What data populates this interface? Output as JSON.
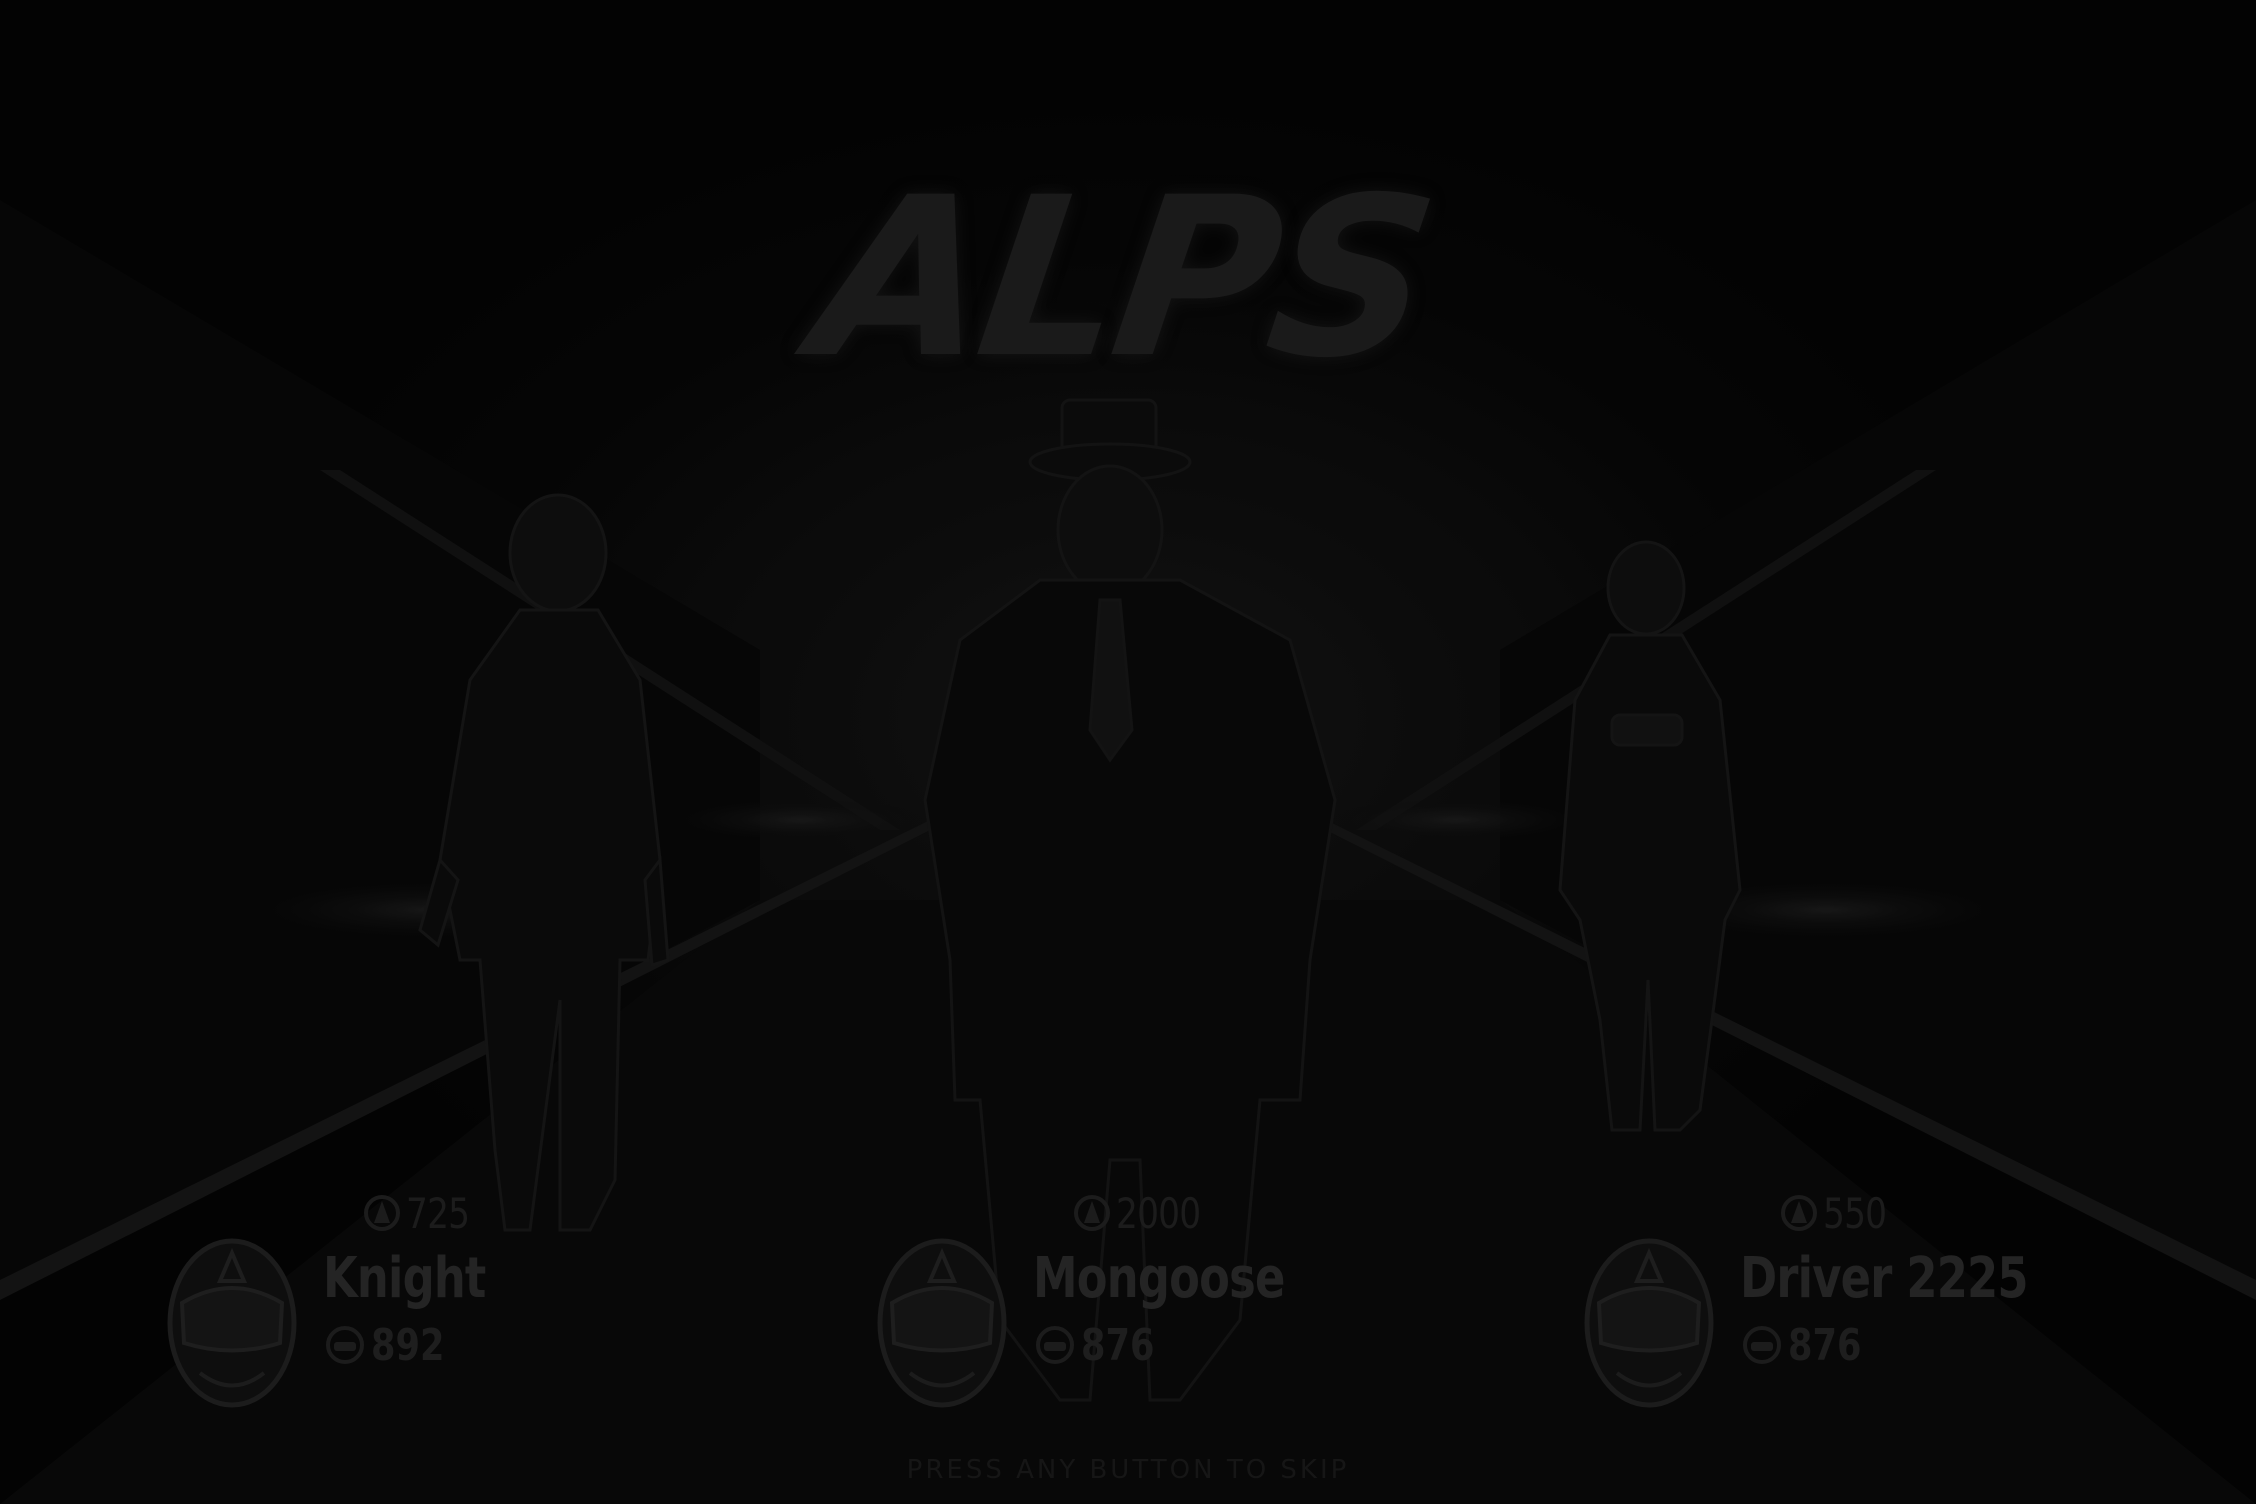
{
  "location_title": "ALPS",
  "drivers": [
    {
      "reputation": "725",
      "name": "Knight",
      "rating": "892"
    },
    {
      "reputation": "2000",
      "name": "Mongoose",
      "rating": "876"
    },
    {
      "reputation": "550",
      "name": "Driver 2225",
      "rating": "876"
    }
  ],
  "skip_prompt": "PRESS ANY BUTTON TO SKIP",
  "icons": {
    "reputation": "reputation-icon",
    "rating": "car-rating-icon",
    "avatar": "helmet-icon"
  },
  "colors": {
    "background": "#050505",
    "text": "#242424"
  }
}
